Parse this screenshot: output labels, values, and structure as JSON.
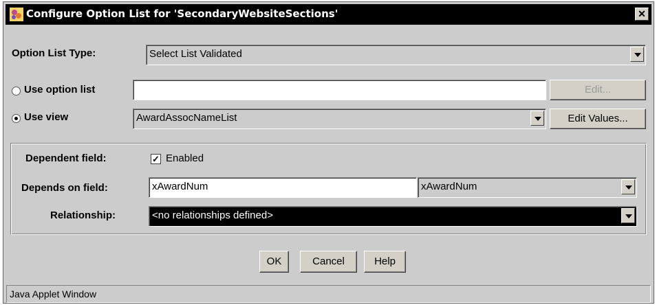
{
  "window": {
    "title": "Configure Option List for 'SecondaryWebsiteSections'",
    "close_glyph": "✕"
  },
  "option_list_type": {
    "label": "Option List Type:",
    "value": "Select List Validated"
  },
  "use_option_list": {
    "label": "Use option list",
    "selected": false,
    "value": "",
    "edit_label": "Edit..."
  },
  "use_view": {
    "label": "Use view",
    "selected": true,
    "value": "AwardAssocNameList",
    "edit_values_label": "Edit Values..."
  },
  "dependent": {
    "label": "Dependent field:",
    "checkbox_label": "Enabled",
    "checked": true,
    "check_glyph": "✓",
    "depends_on_label": "Depends on field:",
    "depends_on_value": "xAwardNum",
    "depends_on_select": "xAwardNum",
    "relationship_label": "Relationship:",
    "relationship_value": "<no relationships defined>"
  },
  "buttons": {
    "ok": "OK",
    "cancel": "Cancel",
    "help": "Help"
  },
  "status_bar": {
    "text": "Java Applet Window"
  },
  "icons": {
    "app": "app-icon",
    "dropdown": "chevron-down-icon"
  },
  "colors": {
    "title_bar": "#000000",
    "dialog_bg": "#cccccc",
    "selected_row": "#000000"
  }
}
